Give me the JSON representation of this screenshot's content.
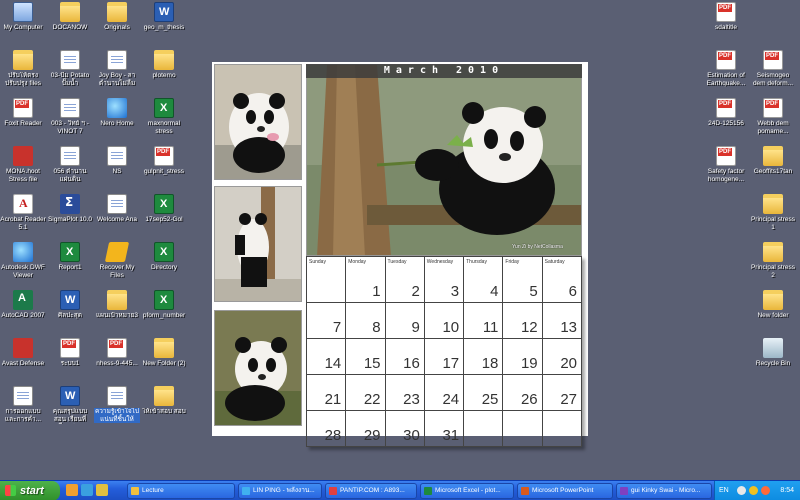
{
  "desktop": {
    "icons_left": [
      {
        "label": "My Computer",
        "glyph": "computer-icon"
      },
      {
        "label": "DOCANOW",
        "glyph": "folder-icon"
      },
      {
        "label": "Originals",
        "glyph": "folder-icon"
      },
      {
        "label": "geo_m_thesis",
        "glyph": "word-doc-icon"
      },
      {
        "label": "ปรับให้ตรง ปรับปรุง files",
        "glyph": "folder-icon"
      },
      {
        "label": "03-ปั๊ม Potato ปั๊มน้ำ",
        "glyph": "document-icon"
      },
      {
        "label": "Joy Boy - ลา ตำนานไม่ลืม",
        "glyph": "document-icon"
      },
      {
        "label": "plotemo",
        "glyph": "folder-icon"
      },
      {
        "label": "Foxit Reader",
        "glyph": "pdf-icon"
      },
      {
        "label": "003 - วิทย์ ฯ - VINOT 7",
        "glyph": "document-icon"
      },
      {
        "label": "Nero Home",
        "glyph": "globe-icon"
      },
      {
        "label": "maxnormal stress",
        "glyph": "excel-icon"
      },
      {
        "label": "MONA.hoot Stress file",
        "glyph": "shield-icon"
      },
      {
        "label": "056 ตำนาน แผ่นดิน",
        "glyph": "document-icon"
      },
      {
        "label": "NS",
        "glyph": "document-icon"
      },
      {
        "label": "gulpnit_stress",
        "glyph": "pdf-icon"
      },
      {
        "label": "Acrobat Reader 5.1",
        "glyph": "acrobat-icon"
      },
      {
        "label": "SigmaPlot 10.0",
        "glyph": "sigma-icon"
      },
      {
        "label": "Welcome Ana",
        "glyph": "document-icon"
      },
      {
        "label": "17sep52-Gol",
        "glyph": "excel-icon"
      },
      {
        "label": "Autodesk DWF Viewer",
        "glyph": "globe-icon"
      },
      {
        "label": "Report1",
        "glyph": "excel-icon"
      },
      {
        "label": "Recover My Files",
        "glyph": "recover-icon"
      },
      {
        "label": "Directory",
        "glyph": "excel-icon"
      },
      {
        "label": "AutoCAD 2007",
        "glyph": "autocad-icon"
      },
      {
        "label": "ศิลปะสุด",
        "glyph": "word-doc-icon"
      },
      {
        "label": "แผนเป้าหมาย3",
        "glyph": "folder-icon"
      },
      {
        "label": "pform_number",
        "glyph": "excel-icon"
      },
      {
        "label": "Avast Defense",
        "glyph": "shield-icon"
      },
      {
        "label": "ระบบ1",
        "glyph": "pdf-icon"
      },
      {
        "label": "nhess-9-445...",
        "glyph": "pdf-icon"
      },
      {
        "label": "New Folder (2)",
        "glyph": "folder-icon"
      },
      {
        "label": "การออกแบบ และการคำ...",
        "glyph": "document-icon"
      },
      {
        "label": "คุณสรุปแบบสอน เรียนที่เรียนสร...",
        "glyph": "word-doc-icon"
      },
      {
        "label": "ความรู้เข้าใจไป แน่นที่ชิ้นให้",
        "glyph": "document-icon"
      },
      {
        "label": "ให้เข้าสอบ สอบ",
        "glyph": "folder-icon"
      }
    ],
    "icons_right": [
      {
        "label": "sdaltitle",
        "glyph": "pdf-icon"
      },
      {
        "label": "Estimation of Earthquake...",
        "glyph": "pdf-icon"
      },
      {
        "label": "Seismogeo dem deform...",
        "glyph": "pdf-icon"
      },
      {
        "label": "24D-125156",
        "glyph": "pdf-icon"
      },
      {
        "label": "Webb dem pomarne...",
        "glyph": "pdf-icon"
      },
      {
        "label": "Safety factor homogene...",
        "glyph": "pdf-icon"
      },
      {
        "label": "Geoffits17tan",
        "glyph": "folder-icon"
      },
      {
        "label": "Principal stress 1",
        "glyph": "folder-icon"
      },
      {
        "label": "Principal stress 2",
        "glyph": "folder-icon"
      },
      {
        "label": "New folder",
        "glyph": "folder-icon"
      },
      {
        "label": "Recycle Bin",
        "glyph": "recycle-bin-icon"
      }
    ]
  },
  "calendar": {
    "month_title": "March 2010",
    "photo_credit": "Yun Zi by NetCollasma",
    "weekdays": [
      "Sunday",
      "Monday",
      "Tuesday",
      "Wednesday",
      "Thursday",
      "Friday",
      "Saturday"
    ],
    "weeks": [
      [
        "",
        "1",
        "2",
        "3",
        "4",
        "5",
        "6"
      ],
      [
        "7",
        "8",
        "9",
        "10",
        "11",
        "12",
        "13"
      ],
      [
        "14",
        "15",
        "16",
        "17",
        "18",
        "19",
        "20"
      ],
      [
        "21",
        "22",
        "23",
        "24",
        "25",
        "26",
        "27"
      ],
      [
        "28",
        "29",
        "30",
        "31",
        "",
        "",
        ""
      ]
    ]
  },
  "taskbar": {
    "start_label": "start",
    "tasks": [
      {
        "label": "Lecture",
        "icon": "folder-icon"
      },
      {
        "label": "LIN PING - พลังงาน...",
        "icon": "chat-icon"
      },
      {
        "label": "PANTIP.COM : A893...",
        "icon": "browser-icon"
      },
      {
        "label": "Microsoft Excel - plot...",
        "icon": "excel-icon"
      },
      {
        "label": "Microsoft PowerPoint",
        "icon": "powerpoint-icon"
      },
      {
        "label": "gui Kinky Swai - Micro...",
        "icon": "media-icon"
      }
    ],
    "tray": {
      "language": "EN",
      "clock": "8:54"
    }
  }
}
